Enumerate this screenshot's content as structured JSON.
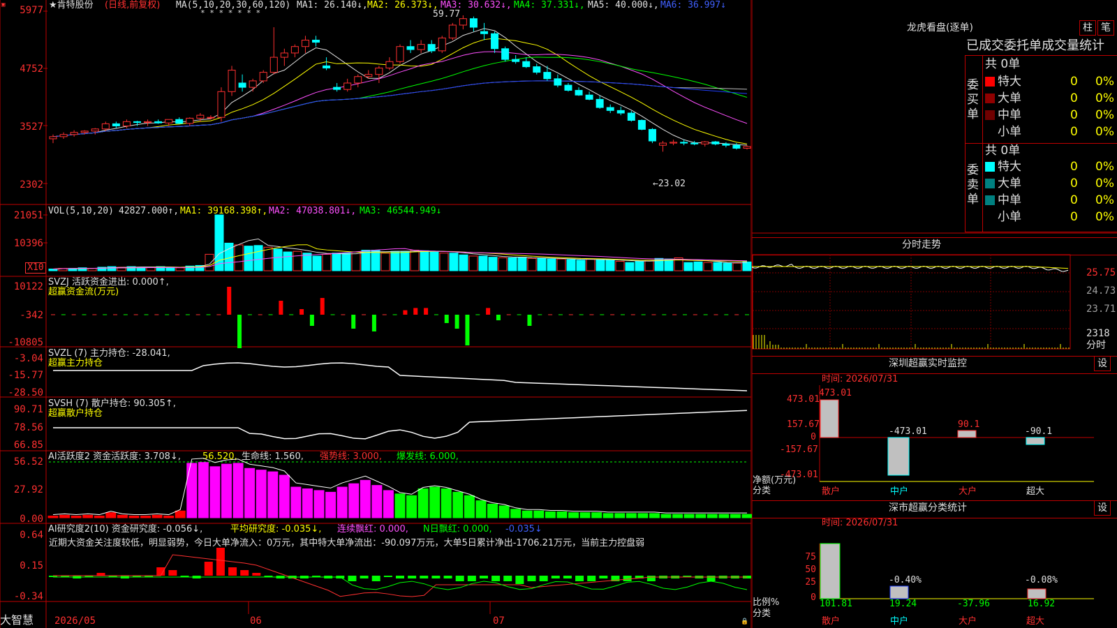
{
  "header": {
    "title": "★肯特股份",
    "mode": "(日线,前复权)",
    "ma_label": "MA(5,10,20,30,60,120)",
    "ma1": "MA1: 26.140↓,",
    "ma2": "MA2: 26.373↓,",
    "ma3": "MA3: 30.632↓,",
    "ma4": "MA4: 37.331↓,",
    "ma5": "MA5: 40.000↓,",
    "ma6": "MA6: 36.997↓",
    "stars": "* * * * *   * *",
    "high_label": "59.77",
    "low_label": "←23.02"
  },
  "price_axis": [
    "5977",
    "4752",
    "3527",
    "2302"
  ],
  "vol": {
    "label": "VOL(5,10,20)",
    "val": "42827.000↑,",
    "ma1": "MA1: 39168.398↑,",
    "ma2": "MA2: 47038.801↓,",
    "ma3": "MA3: 46544.949↓",
    "axis": [
      "21051",
      "10396"
    ],
    "unit": "X10"
  },
  "svzj": {
    "label": "SVZJ  活跃资金进出: 0.000↑,",
    "sub": "超赢资金流(万元)",
    "axis": [
      "10122",
      "-342",
      "-10805"
    ]
  },
  "svzl": {
    "label": "SVZL (7) 主力持仓: -28.041,",
    "sub": "超赢主力持仓",
    "axis": [
      "-3.04",
      "-15.77",
      "-28.50"
    ]
  },
  "svsh": {
    "label": "SVSH (7) 散户持仓: 90.305↑,",
    "sub": "超赢散户持仓",
    "axis": [
      "90.71",
      "78.56",
      "66.85"
    ]
  },
  "ai1": {
    "label": "AI活跃度2 资金活跃度: 3.708↓,",
    "v1": "56.520,",
    "v2": "生命线: 1.560,",
    "v3": "强势线: 3.000,",
    "v4": "爆发线: 6.000,",
    "axis": [
      "56.52",
      "27.92",
      "0.00"
    ]
  },
  "ai2": {
    "label": "AI研究度2(10) 资金研究度: -0.056↓,",
    "v1": "平均研究度: -0.035↓,",
    "v2": "连续飘红: 0.000,",
    "v3": "N日飘红: 0.000,",
    "v4": "-0.035↓",
    "axis": [
      "0.64",
      "0.15",
      "-0.34"
    ],
    "comment": "近期大资金关注度较低，明显弱势，今日大单净流入：0万元，其中特大单净流出：-90.097万元，大单5日累计净出-1706.21万元，当前主力控盘弱"
  },
  "date_axis": [
    "2026/05",
    "06",
    "07"
  ],
  "brand": "大智慧",
  "right": {
    "lhb_title": "龙虎看盘(逐单)",
    "btn_zhu": "柱",
    "btn_bi": "笔",
    "tabs": "已成交委托单成交量统计",
    "buy_label": "委买单",
    "sell_label": "委卖单",
    "buy_total": "共 0单",
    "sell_total": "共 0单",
    "buy_rows": [
      {
        "name": "特大",
        "count": "0",
        "pct": "0%",
        "color": "#ff0000"
      },
      {
        "name": "大单",
        "count": "0",
        "pct": "0%",
        "color": "#900000"
      },
      {
        "name": "中单",
        "count": "0",
        "pct": "0%",
        "color": "#700000"
      },
      {
        "name": "小单",
        "count": "0",
        "pct": "0%",
        "color": "#000000"
      }
    ],
    "sell_rows": [
      {
        "name": "特大",
        "count": "0",
        "pct": "0%",
        "color": "#00ffff"
      },
      {
        "name": "大单",
        "count": "0",
        "pct": "0%",
        "color": "#008080"
      },
      {
        "name": "中单",
        "count": "0",
        "pct": "0%",
        "color": "#008080"
      },
      {
        "name": "小单",
        "count": "0",
        "pct": "0%",
        "color": "#000000"
      }
    ],
    "fs_title": "分时走势",
    "fs_axis": [
      "25.75",
      "24.73",
      "23.71",
      "2318"
    ],
    "fs_unit": "分时",
    "sz_title": "深圳超赢实时监控",
    "sz_btn": "设",
    "sz_time": "时间: 2026/07/31",
    "sz_axis": [
      "473.01",
      "157.67",
      "0",
      "-157.67",
      "-473.01"
    ],
    "sz_unit": "净额(万元)",
    "sz_unit2": "分类",
    "sz_vals": [
      "473.01",
      "-473.01",
      "90.1",
      "-90.1"
    ],
    "cats": [
      "散户",
      "中户",
      "大户",
      "超大"
    ],
    "ss_title": "深市超赢分类统计",
    "ss_btn": "设",
    "ss_time": "时间: 2026/07/31",
    "ss_axis": [
      "75",
      "50",
      "25",
      "0"
    ],
    "ss_unit": "比例%",
    "ss_unit2": "分类",
    "ss_top": [
      "-0.40%",
      "-0.08%"
    ],
    "ss_vals": [
      "101.81",
      "19.24",
      "-37.96",
      "16.92"
    ]
  },
  "chart_data": [
    {
      "type": "candlestick",
      "title": "肯特股份 (日线,前复权)",
      "ylim": [
        23.02,
        59.77
      ],
      "ohlc": [
        [
          31,
          32,
          30,
          31.5
        ],
        [
          31.5,
          32.5,
          31,
          32
        ],
        [
          32,
          33,
          31.5,
          32.5
        ],
        [
          32.5,
          33,
          32,
          32.8
        ],
        [
          32.8,
          33.5,
          32,
          33.3
        ],
        [
          33.3,
          35,
          32.8,
          34.5
        ],
        [
          34.5,
          35,
          33.5,
          34
        ],
        [
          34,
          35.5,
          33.5,
          35
        ],
        [
          35,
          35.2,
          34,
          34.8
        ],
        [
          34.8,
          35.5,
          34,
          35
        ],
        [
          35,
          35.5,
          34.5,
          34.7
        ],
        [
          34.7,
          35.5,
          34,
          35.5
        ],
        [
          35.5,
          36,
          34.5,
          34.6
        ],
        [
          34.6,
          36,
          34,
          35.8
        ],
        [
          35.8,
          37,
          35,
          36.5
        ],
        [
          36,
          36.5,
          35.5,
          36
        ],
        [
          36,
          43,
          35,
          42
        ],
        [
          42,
          48,
          41,
          47
        ],
        [
          44,
          46,
          42,
          43
        ],
        [
          43,
          45,
          42,
          44.5
        ],
        [
          44.5,
          47,
          44,
          46.5
        ],
        [
          46.5,
          57,
          46,
          50
        ],
        [
          50,
          52,
          48,
          51
        ],
        [
          51,
          53,
          50,
          52.5
        ],
        [
          52.5,
          55,
          51,
          54
        ],
        [
          54,
          55,
          52.5,
          53.5
        ],
        [
          48,
          50,
          47,
          47.5
        ],
        [
          43,
          44,
          42,
          42.5
        ],
        [
          42.5,
          45,
          42,
          44
        ],
        [
          44,
          46,
          43,
          45.5
        ],
        [
          45.5,
          47,
          45,
          46
        ],
        [
          46,
          48,
          44,
          47.5
        ],
        [
          47.5,
          50,
          47,
          49
        ],
        [
          49,
          53,
          48.5,
          52.5
        ],
        [
          52.5,
          54,
          51,
          51.8
        ],
        [
          51.8,
          54,
          51,
          53
        ],
        [
          53,
          54,
          51,
          51.5
        ],
        [
          51.5,
          55,
          51,
          54.5
        ],
        [
          54.5,
          58,
          54,
          57.5
        ],
        [
          57.5,
          59.77,
          56.5,
          59
        ],
        [
          59,
          59.5,
          56,
          57
        ],
        [
          56,
          58,
          54,
          55.5
        ],
        [
          55.5,
          56,
          51,
          52
        ],
        [
          52,
          52.5,
          49,
          49.5
        ],
        [
          49.5,
          50.5,
          48.5,
          49
        ],
        [
          49,
          50,
          47.5,
          47.8
        ],
        [
          47.8,
          48.5,
          46,
          46.5
        ],
        [
          46.5,
          48,
          44.5,
          45
        ],
        [
          45,
          46,
          43,
          43.5
        ],
        [
          43.5,
          44,
          42,
          42.3
        ],
        [
          42.3,
          43,
          41,
          41.2
        ],
        [
          41.2,
          42,
          40,
          40.2
        ],
        [
          40.2,
          41,
          38,
          38.3
        ],
        [
          38.3,
          39,
          37,
          37.6
        ],
        [
          37.6,
          38.5,
          36.5,
          37
        ],
        [
          37,
          37.5,
          35,
          35.3
        ],
        [
          35.3,
          35.5,
          33,
          33.2
        ],
        [
          33.2,
          33.5,
          30,
          30.5
        ],
        [
          29.5,
          30.5,
          28,
          30
        ],
        [
          30,
          30.8,
          29.5,
          30.2
        ],
        [
          30.2,
          30.8,
          29.5,
          30
        ],
        [
          30,
          30.5,
          29.5,
          29.8
        ],
        [
          29.8,
          30.5,
          29.2,
          30.3
        ],
        [
          30.3,
          30.5,
          29.5,
          29.8
        ],
        [
          29.8,
          30.2,
          29,
          29.5
        ],
        [
          29.5,
          30,
          28.5,
          28.8
        ],
        [
          28.8,
          29.5,
          28.5,
          29.2
        ]
      ]
    },
    {
      "type": "bar",
      "title": "VOL",
      "values": [
        3,
        4,
        4,
        5,
        4,
        6,
        7,
        6,
        7,
        6,
        6,
        7,
        6,
        5,
        8,
        9,
        28,
        95,
        47,
        44,
        42,
        43,
        40,
        37,
        32,
        33,
        30,
        25,
        28,
        30,
        30,
        32,
        35,
        35,
        30,
        33,
        33,
        35,
        34,
        32,
        30,
        30,
        27,
        25,
        25,
        23,
        22,
        22,
        23,
        21,
        21,
        20,
        20,
        19,
        18,
        20,
        19,
        18,
        16,
        14,
        16,
        18,
        21,
        20,
        22,
        14,
        15,
        14,
        14,
        13,
        13,
        15
      ]
    },
    {
      "type": "bar",
      "title": "超赢资金流(万元)",
      "values": [
        0,
        0,
        0,
        0,
        0,
        0,
        0,
        0,
        0,
        0,
        0,
        0,
        0,
        0,
        0,
        0,
        0,
        50,
        -60,
        0,
        0,
        0,
        25,
        0,
        10,
        -20,
        30,
        0,
        0,
        -25,
        0,
        -30,
        0,
        0,
        8,
        12,
        12,
        0,
        -15,
        -25,
        -55,
        0,
        12,
        -10,
        0,
        0,
        -20,
        0,
        0,
        0,
        0,
        0,
        0,
        0,
        0,
        0,
        0,
        0,
        0,
        0,
        0,
        0,
        0,
        0,
        0,
        0,
        0,
        0
      ]
    }
  ]
}
